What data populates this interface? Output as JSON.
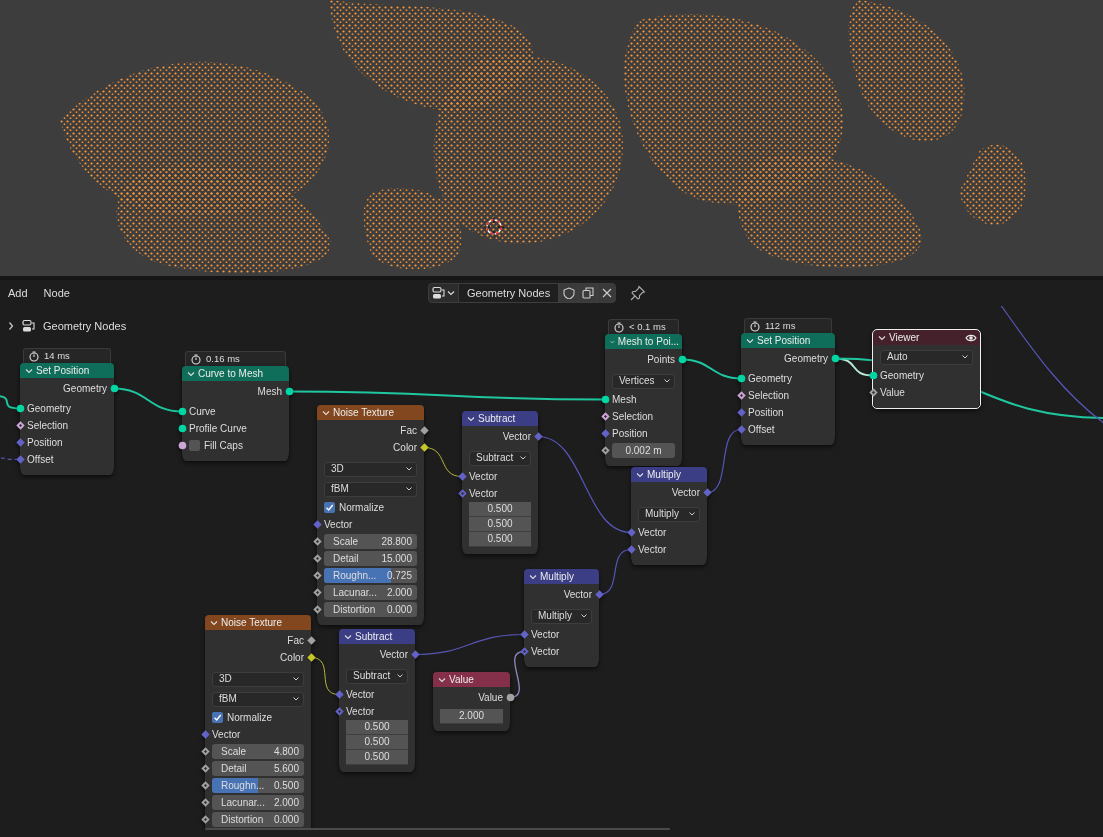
{
  "header": {
    "menus": [
      "Add",
      "Node"
    ],
    "node_tree": "Geometry Nodes"
  },
  "breadcrumb": {
    "expanded": false,
    "label": "Geometry Nodes"
  },
  "nodes": [
    {
      "title": "Set Position",
      "kind": "geometry",
      "timing": "14 ms",
      "selected": false,
      "rows": [
        {
          "kind": "output",
          "label": "Geometry",
          "socket": {
            "kind": "circle",
            "color": "#00d6a3",
            "hollow": false
          }
        },
        {
          "kind": "input",
          "label": "Geometry",
          "socket": {
            "kind": "circle",
            "color": "#00d6a3",
            "hollow": false
          }
        },
        {
          "kind": "input",
          "label": "Selection",
          "socket": {
            "kind": "diamond",
            "color": "#cca6d6",
            "hollow": true
          }
        },
        {
          "kind": "input",
          "label": "Position",
          "socket": {
            "kind": "diamond",
            "color": "#6363c7",
            "hollow": false
          }
        },
        {
          "kind": "input",
          "label": "Offset",
          "socket": {
            "kind": "diamond",
            "color": "#6363c7",
            "hollow": false
          }
        }
      ]
    },
    {
      "title": "Curve to Mesh",
      "kind": "geometry",
      "timing": "0.16 ms",
      "selected": false,
      "rows": [
        {
          "kind": "output",
          "label": "Mesh",
          "socket": {
            "kind": "circle",
            "color": "#00d6a3",
            "hollow": false
          }
        },
        {
          "kind": "input",
          "label": "Curve",
          "socket": {
            "kind": "circle",
            "color": "#00d6a3",
            "hollow": false
          }
        },
        {
          "kind": "input",
          "label": "Profile Curve",
          "socket": {
            "kind": "circle",
            "color": "#00d6a3",
            "hollow": false
          }
        },
        {
          "kind": "checkbox",
          "label": "Fill Caps",
          "checked": false,
          "socket": {
            "kind": "circle",
            "color": "#cca6d6",
            "hollow": false
          }
        }
      ]
    },
    {
      "title": "Noise Texture",
      "kind": "texture",
      "selected": false,
      "rows": [
        {
          "kind": "output",
          "label": "Fac",
          "socket": {
            "kind": "diamond",
            "color": "#a1a1a1",
            "hollow": false
          }
        },
        {
          "kind": "output",
          "label": "Color",
          "socket": {
            "kind": "diamond",
            "color": "#c7c729",
            "hollow": false
          }
        },
        {
          "kind": "dropdown",
          "value": "3D"
        },
        {
          "kind": "dropdown",
          "value": "fBM"
        },
        {
          "kind": "checkbox",
          "label": "Normalize",
          "checked": true
        },
        {
          "kind": "input",
          "label": "Vector",
          "socket": {
            "kind": "diamond",
            "color": "#6363c7",
            "hollow": false
          }
        },
        {
          "kind": "number",
          "label": "Scale",
          "value": "28.800",
          "socket": {
            "kind": "diamond",
            "color": "#a1a1a1",
            "hollow": true
          }
        },
        {
          "kind": "number",
          "label": "Detail",
          "value": "15.000",
          "socket": {
            "kind": "diamond",
            "color": "#a1a1a1",
            "hollow": true
          }
        },
        {
          "kind": "slider",
          "label": "Roughn...",
          "value": "0.725",
          "level": 0.725,
          "socket": {
            "kind": "diamond",
            "color": "#a1a1a1",
            "hollow": true
          }
        },
        {
          "kind": "number",
          "label": "Lacunar...",
          "value": "2.000",
          "socket": {
            "kind": "diamond",
            "color": "#a1a1a1",
            "hollow": true
          }
        },
        {
          "kind": "number",
          "label": "Distortion",
          "value": "0.000",
          "socket": {
            "kind": "diamond",
            "color": "#a1a1a1",
            "hollow": true
          }
        }
      ]
    },
    {
      "title": "Subtract",
      "kind": "vector",
      "selected": false,
      "rows": [
        {
          "kind": "output",
          "label": "Vector",
          "socket": {
            "kind": "diamond",
            "color": "#6363c7",
            "hollow": false
          }
        },
        {
          "kind": "dropdown",
          "value": "Subtract"
        },
        {
          "kind": "input",
          "label": "Vector",
          "socket": {
            "kind": "diamond",
            "color": "#6363c7",
            "hollow": false
          }
        },
        {
          "kind": "input",
          "label": "Vector",
          "socket": {
            "kind": "diamond",
            "color": "#6363c7",
            "hollow": true
          }
        },
        {
          "kind": "value",
          "value": "0.500"
        },
        {
          "kind": "value",
          "value": "0.500"
        },
        {
          "kind": "value",
          "value": "0.500"
        }
      ]
    },
    {
      "title": "Mesh to Poi...",
      "kind": "geometry",
      "timing": "< 0.1 ms",
      "selected": false,
      "rows": [
        {
          "kind": "output",
          "label": "Points",
          "socket": {
            "kind": "circle",
            "color": "#00d6a3",
            "hollow": false
          }
        },
        {
          "kind": "dropdown",
          "value": "Vertices"
        },
        {
          "kind": "input",
          "label": "Mesh",
          "socket": {
            "kind": "circle",
            "color": "#00d6a3",
            "hollow": false
          }
        },
        {
          "kind": "input",
          "label": "Selection",
          "socket": {
            "kind": "diamond",
            "color": "#cca6d6",
            "hollow": true
          }
        },
        {
          "kind": "input",
          "label": "Position",
          "socket": {
            "kind": "diamond",
            "color": "#6363c7",
            "hollow": false
          }
        },
        {
          "kind": "value",
          "value": "0.002 m",
          "socket": {
            "kind": "diamond",
            "color": "#a1a1a1",
            "hollow": true
          }
        }
      ]
    },
    {
      "title": "Set Position",
      "kind": "geometry",
      "timing": "112 ms",
      "selected": false,
      "rows": [
        {
          "kind": "output",
          "label": "Geometry",
          "socket": {
            "kind": "circle",
            "color": "#00d6a3",
            "hollow": false
          }
        },
        {
          "kind": "input",
          "label": "Geometry",
          "socket": {
            "kind": "circle",
            "color": "#00d6a3",
            "hollow": false
          }
        },
        {
          "kind": "input",
          "label": "Selection",
          "socket": {
            "kind": "diamond",
            "color": "#cca6d6",
            "hollow": true
          }
        },
        {
          "kind": "input",
          "label": "Position",
          "socket": {
            "kind": "diamond",
            "color": "#6363c7",
            "hollow": false
          }
        },
        {
          "kind": "input",
          "label": "Offset",
          "socket": {
            "kind": "diamond",
            "color": "#6363c7",
            "hollow": false
          }
        }
      ]
    },
    {
      "title": "Viewer",
      "kind": "output",
      "selected": true,
      "rows": [
        {
          "kind": "dropdown",
          "value": "Auto"
        },
        {
          "kind": "input",
          "label": "Geometry",
          "socket": {
            "kind": "circle",
            "color": "#00d6a3",
            "hollow": false
          }
        },
        {
          "kind": "input",
          "label": "Value",
          "socket": {
            "kind": "diamond",
            "color": "#a1a1a1",
            "hollow": true
          }
        }
      ]
    },
    {
      "title": "Multiply",
      "kind": "vector",
      "selected": false,
      "rows": [
        {
          "kind": "output",
          "label": "Vector",
          "socket": {
            "kind": "diamond",
            "color": "#6363c7",
            "hollow": false
          }
        },
        {
          "kind": "dropdown",
          "value": "Multiply"
        },
        {
          "kind": "input",
          "label": "Vector",
          "socket": {
            "kind": "diamond",
            "color": "#6363c7",
            "hollow": false
          }
        },
        {
          "kind": "input",
          "label": "Vector",
          "socket": {
            "kind": "diamond",
            "color": "#6363c7",
            "hollow": false
          }
        }
      ]
    },
    {
      "title": "Multiply",
      "kind": "vector",
      "selected": false,
      "rows": [
        {
          "kind": "output",
          "label": "Vector",
          "socket": {
            "kind": "diamond",
            "color": "#6363c7",
            "hollow": false
          }
        },
        {
          "kind": "dropdown",
          "value": "Multiply"
        },
        {
          "kind": "input",
          "label": "Vector",
          "socket": {
            "kind": "diamond",
            "color": "#6363c7",
            "hollow": false
          }
        },
        {
          "kind": "input",
          "label": "Vector",
          "socket": {
            "kind": "diamond",
            "color": "#6363c7",
            "hollow": true
          }
        }
      ]
    },
    {
      "title": "Noise Texture",
      "kind": "texture",
      "selected": false,
      "rows": [
        {
          "kind": "output",
          "label": "Fac",
          "socket": {
            "kind": "diamond",
            "color": "#a1a1a1",
            "hollow": false
          }
        },
        {
          "kind": "output",
          "label": "Color",
          "socket": {
            "kind": "diamond",
            "color": "#c7c729",
            "hollow": false
          }
        },
        {
          "kind": "dropdown",
          "value": "3D"
        },
        {
          "kind": "dropdown",
          "value": "fBM"
        },
        {
          "kind": "checkbox",
          "label": "Normalize",
          "checked": true
        },
        {
          "kind": "input",
          "label": "Vector",
          "socket": {
            "kind": "diamond",
            "color": "#6363c7",
            "hollow": false
          }
        },
        {
          "kind": "number",
          "label": "Scale",
          "value": "4.800",
          "socket": {
            "kind": "diamond",
            "color": "#a1a1a1",
            "hollow": true
          }
        },
        {
          "kind": "number",
          "label": "Detail",
          "value": "5.600",
          "socket": {
            "kind": "diamond",
            "color": "#a1a1a1",
            "hollow": true
          }
        },
        {
          "kind": "slider",
          "label": "Roughn...",
          "value": "0.500",
          "level": 0.5,
          "socket": {
            "kind": "diamond",
            "color": "#a1a1a1",
            "hollow": true
          }
        },
        {
          "kind": "number",
          "label": "Lacunar...",
          "value": "2.000",
          "socket": {
            "kind": "diamond",
            "color": "#a1a1a1",
            "hollow": true
          }
        },
        {
          "kind": "number",
          "label": "Distortion",
          "value": "0.000",
          "socket": {
            "kind": "diamond",
            "color": "#a1a1a1",
            "hollow": true
          }
        }
      ]
    },
    {
      "title": "Subtract",
      "kind": "vector",
      "selected": false,
      "rows": [
        {
          "kind": "output",
          "label": "Vector",
          "socket": {
            "kind": "diamond",
            "color": "#6363c7",
            "hollow": false
          }
        },
        {
          "kind": "dropdown",
          "value": "Subtract"
        },
        {
          "kind": "input",
          "label": "Vector",
          "socket": {
            "kind": "diamond",
            "color": "#6363c7",
            "hollow": false
          }
        },
        {
          "kind": "input",
          "label": "Vector",
          "socket": {
            "kind": "diamond",
            "color": "#6363c7",
            "hollow": true
          }
        },
        {
          "kind": "value",
          "value": "0.500"
        },
        {
          "kind": "value",
          "value": "0.500"
        },
        {
          "kind": "value",
          "value": "0.500"
        }
      ]
    },
    {
      "title": "Value",
      "kind": "input",
      "selected": false,
      "rows": [
        {
          "kind": "output",
          "label": "Value",
          "socket": {
            "kind": "circle",
            "color": "#a1a1a1",
            "hollow": false
          }
        },
        {
          "kind": "value",
          "value": "2.000"
        }
      ]
    }
  ]
}
